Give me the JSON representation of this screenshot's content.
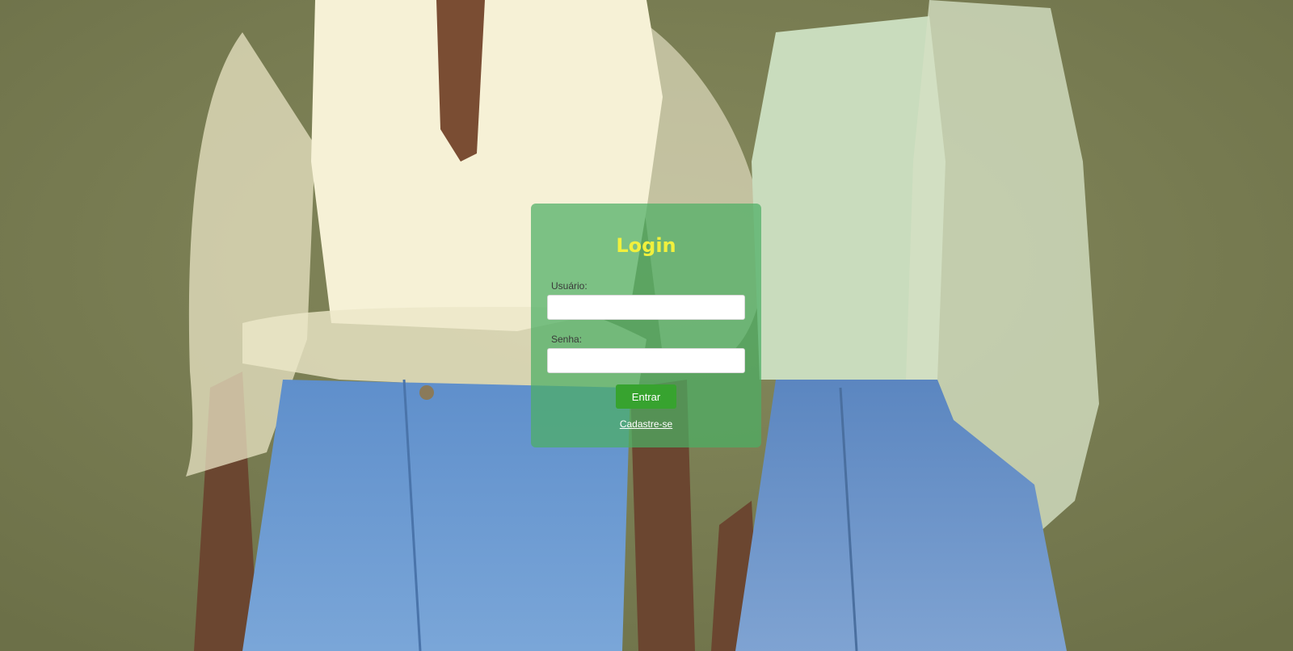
{
  "login": {
    "title": "Login",
    "username_label": "Usuário:",
    "username_value": "",
    "password_label": "Senha:",
    "password_value": "",
    "submit_label": "Entrar",
    "register_link": "Cadastre-se"
  },
  "colors": {
    "card_background": "#4caf64",
    "title": "#f1f03d",
    "submit_button": "#37a32f",
    "wall_background": "#7d8058"
  }
}
